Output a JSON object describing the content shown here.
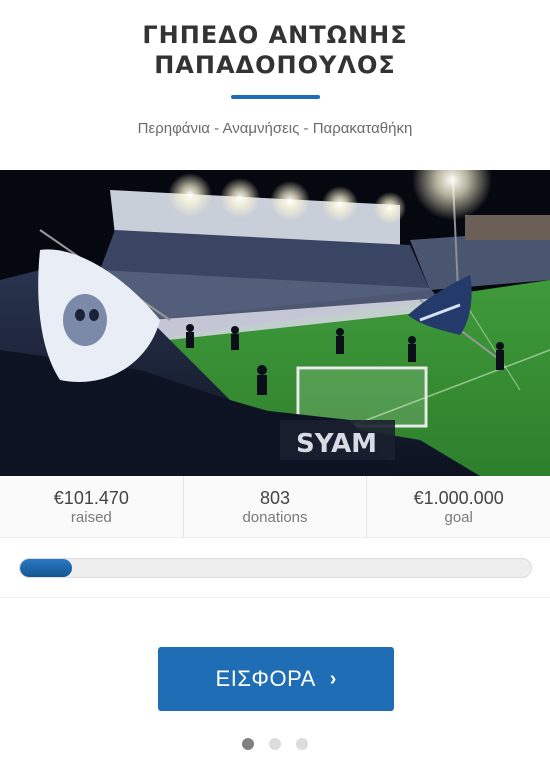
{
  "header": {
    "title_lines": [
      "ΓΗΠΕΔΟ ΑΝΤΩΝΗΣ",
      "ΠΑΠΑΔΟΠΟΥΛΟΣ"
    ],
    "subtitle": "Περηφάνια - Αναμνήσεις - Παρακαταθήκη",
    "accent_color": "#1f6db5"
  },
  "hero": {
    "banner_text": "SYAM"
  },
  "stats": [
    {
      "value": "€101.470",
      "label": "raised"
    },
    {
      "value": "803",
      "label": "donations"
    },
    {
      "value": "€1.000.000",
      "label": "goal"
    }
  ],
  "progress": {
    "fraction": 0.10147,
    "fill_color": "#1f6db5"
  },
  "cta": {
    "label": "ΕΙΣΦΟΡΑ",
    "icon": "chevron-right-icon",
    "icon_glyph": "›"
  },
  "carousel": {
    "count": 3,
    "active_index": 0
  }
}
